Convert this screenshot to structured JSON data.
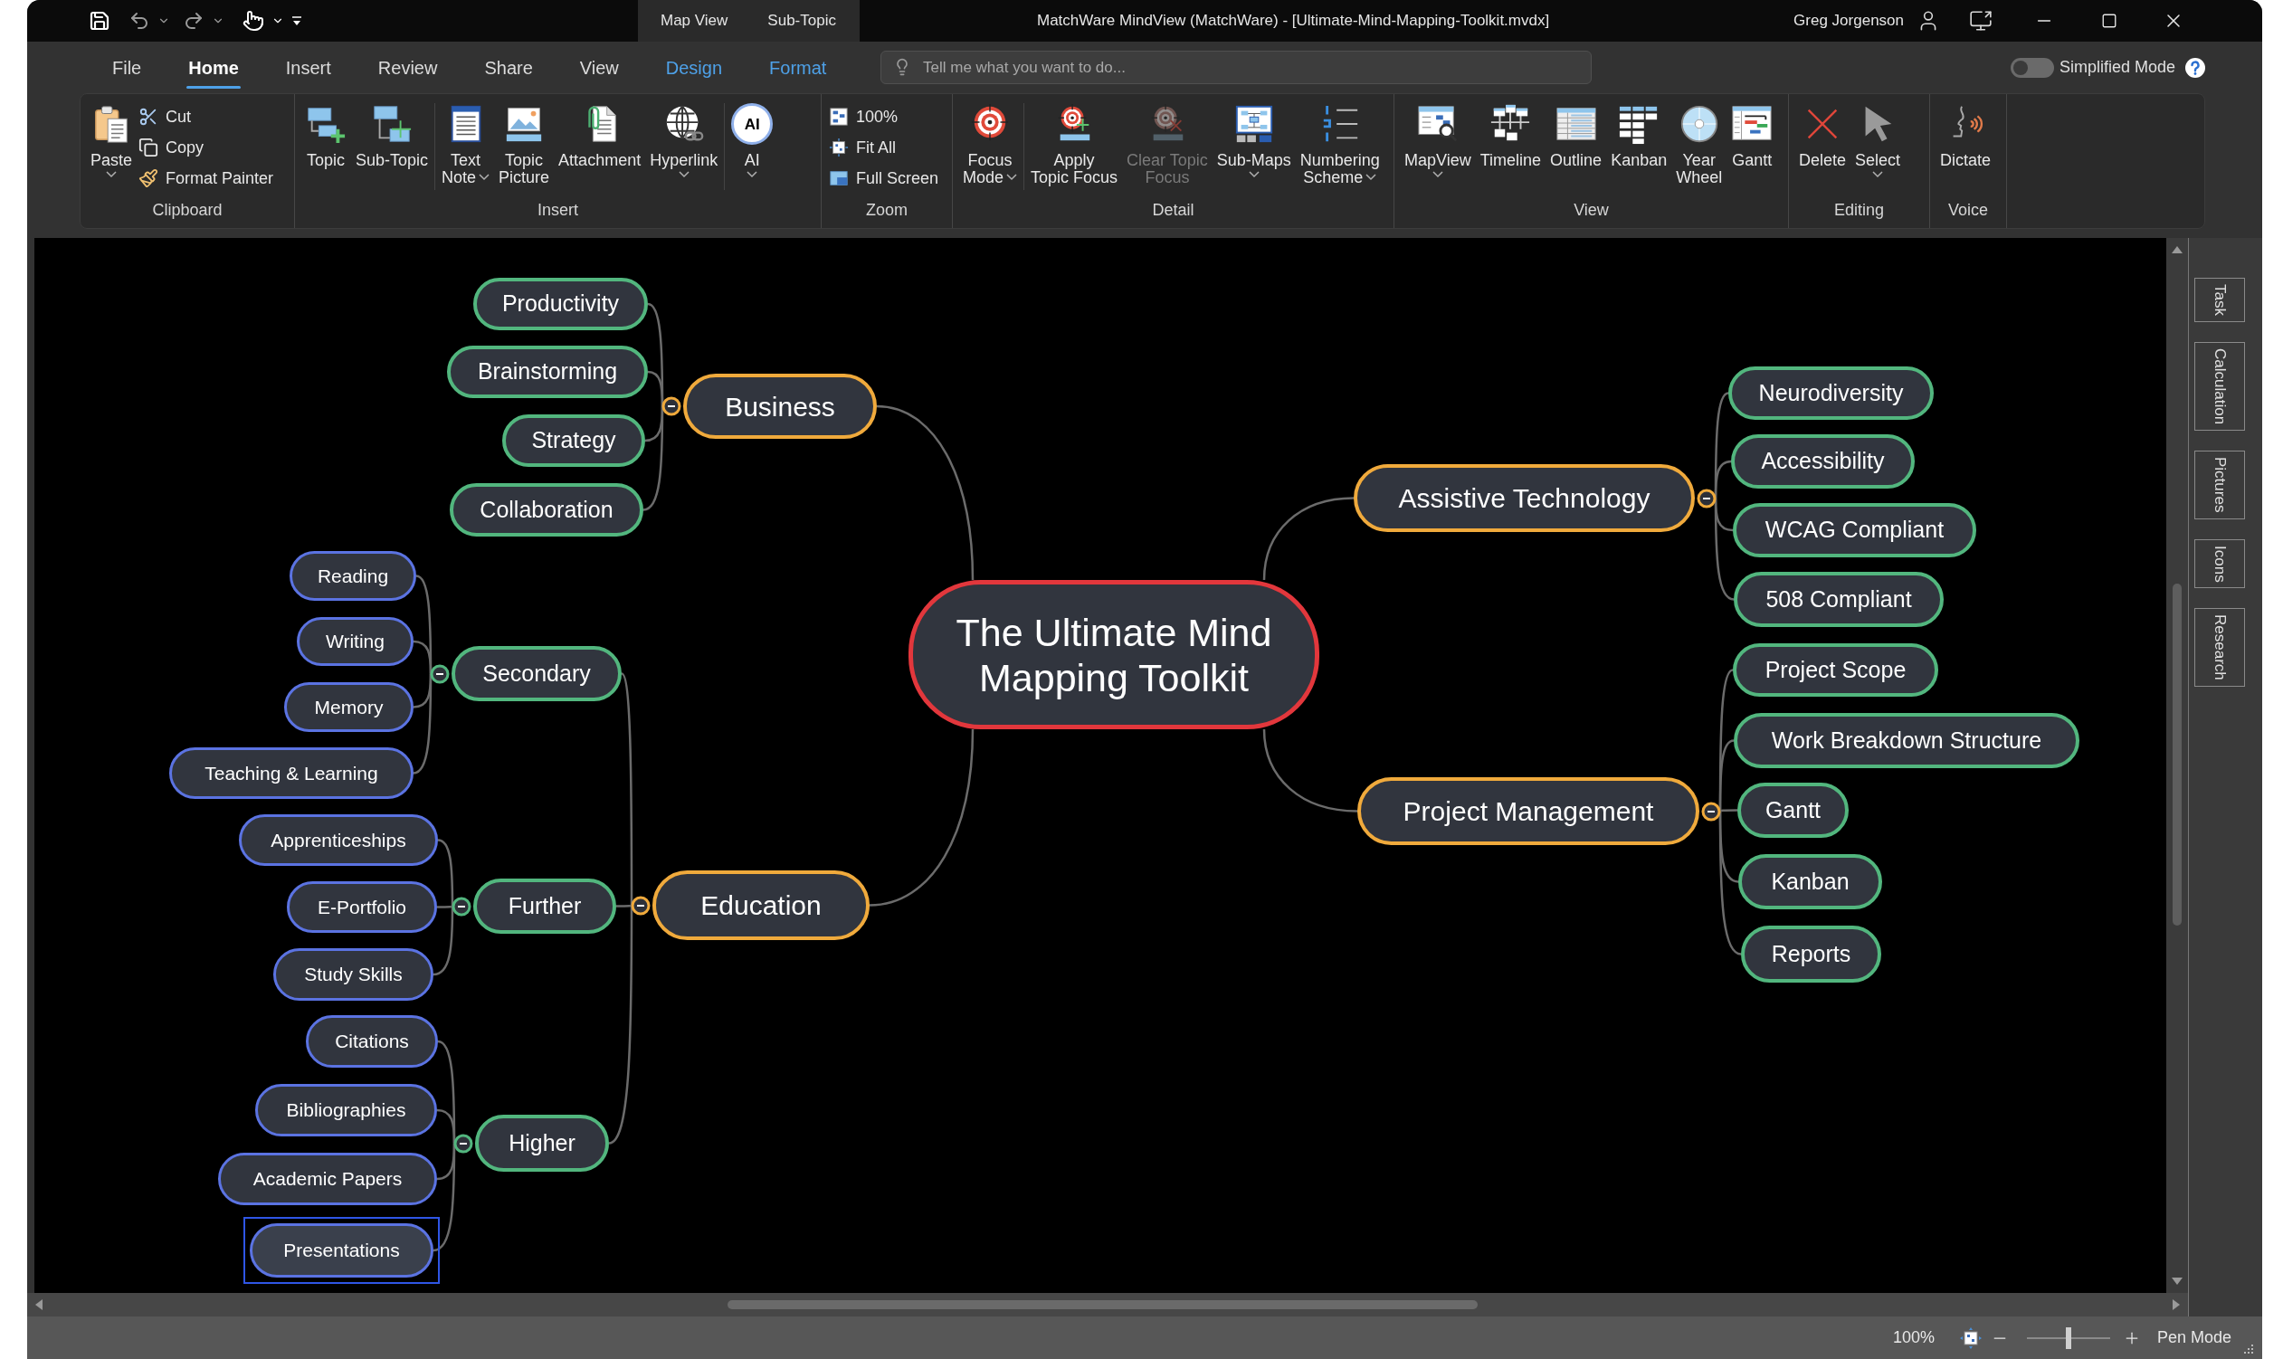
{
  "title_bar": {
    "context_tabs": [
      "Map View",
      "Sub-Topic"
    ],
    "title": "MatchWare MindView (MatchWare) - [Ultimate-Mind-Mapping-Toolkit.mvdx]",
    "user": "Greg Jorgenson"
  },
  "menu_tabs": [
    {
      "label": "File",
      "kind": "standard",
      "selected": false
    },
    {
      "label": "Home",
      "kind": "standard",
      "selected": true
    },
    {
      "label": "Insert",
      "kind": "standard",
      "selected": false
    },
    {
      "label": "Review",
      "kind": "standard",
      "selected": false
    },
    {
      "label": "Share",
      "kind": "standard",
      "selected": false
    },
    {
      "label": "View",
      "kind": "standard",
      "selected": false
    },
    {
      "label": "Design",
      "kind": "contextual",
      "selected": false
    },
    {
      "label": "Format",
      "kind": "contextual",
      "selected": false
    }
  ],
  "search": {
    "placeholder": "Tell me what you want to do..."
  },
  "simplified_mode": {
    "label": "Simplified Mode",
    "on": false
  },
  "ribbon": {
    "groups": [
      {
        "label": "Clipboard",
        "items": [
          {
            "label": "Paste",
            "kind": "large",
            "dropdown": true
          },
          {
            "label": "Cut",
            "kind": "small"
          },
          {
            "label": "Copy",
            "kind": "small"
          },
          {
            "label": "Format Painter",
            "kind": "small"
          }
        ]
      },
      {
        "label": "Insert",
        "items": [
          {
            "label": "Topic",
            "kind": "large"
          },
          {
            "label": "Sub-Topic",
            "kind": "large"
          },
          {
            "label": "Text\nNote",
            "kind": "large",
            "dropdown": true
          },
          {
            "label": "Topic\nPicture",
            "kind": "large"
          },
          {
            "label": "Attachment",
            "kind": "large"
          },
          {
            "label": "Hyperlink",
            "kind": "large",
            "dropdown": true
          },
          {
            "label": "AI",
            "kind": "large",
            "dropdown": true,
            "icon_text": "AI"
          }
        ]
      },
      {
        "label": "Zoom",
        "items": [
          {
            "label": "100%",
            "kind": "small"
          },
          {
            "label": "Fit All",
            "kind": "small"
          },
          {
            "label": "Full Screen",
            "kind": "small"
          }
        ]
      },
      {
        "label": "Detail",
        "items": [
          {
            "label": "Focus\nMode",
            "kind": "large",
            "dropdown": true,
            "disabled": false
          },
          {
            "label": "Apply\nTopic Focus",
            "kind": "large",
            "disabled": false
          },
          {
            "label": "Clear Topic\nFocus",
            "kind": "large",
            "disabled": true
          },
          {
            "label": "Sub-Maps",
            "kind": "large",
            "dropdown": true,
            "disabled": false
          },
          {
            "label": "Numbering\nScheme",
            "kind": "large",
            "dropdown": true,
            "disabled": false
          }
        ]
      },
      {
        "label": "View",
        "items": [
          {
            "label": "MapView",
            "kind": "large",
            "dropdown": true
          },
          {
            "label": "Timeline",
            "kind": "large"
          },
          {
            "label": "Outline",
            "kind": "large"
          },
          {
            "label": "Kanban",
            "kind": "large"
          },
          {
            "label": "Year\nWheel",
            "kind": "large"
          },
          {
            "label": "Gantt",
            "kind": "large"
          }
        ]
      },
      {
        "label": "Editing",
        "items": [
          {
            "label": "Delete",
            "kind": "large"
          },
          {
            "label": "Select",
            "kind": "large",
            "dropdown": true
          }
        ]
      },
      {
        "label": "Voice",
        "items": [
          {
            "label": "Dictate",
            "kind": "large"
          }
        ]
      }
    ]
  },
  "mind_map": {
    "central_topic": {
      "text": "The Ultimate Mind Mapping Toolkit",
      "selected": false
    },
    "branches": [
      {
        "text": "Business",
        "selected": false,
        "expanded": true,
        "children": [
          {
            "text": "Productivity",
            "selected": false
          },
          {
            "text": "Brainstorming",
            "selected": false
          },
          {
            "text": "Strategy",
            "selected": false
          },
          {
            "text": "Collaboration",
            "selected": false
          }
        ]
      },
      {
        "text": "Education",
        "selected": false,
        "expanded": true,
        "children": [
          {
            "text": "Secondary",
            "selected": false,
            "expanded": true,
            "children": [
              {
                "text": "Reading",
                "selected": false
              },
              {
                "text": "Writing",
                "selected": false
              },
              {
                "text": "Memory",
                "selected": false
              },
              {
                "text": "Teaching & Learning",
                "selected": false
              }
            ]
          },
          {
            "text": "Further",
            "selected": false,
            "expanded": true,
            "children": [
              {
                "text": "Apprenticeships",
                "selected": false
              },
              {
                "text": "E-Portfolio",
                "selected": false
              },
              {
                "text": "Study Skills",
                "selected": false
              }
            ]
          },
          {
            "text": "Higher",
            "selected": false,
            "expanded": true,
            "children": [
              {
                "text": "Citations",
                "selected": false
              },
              {
                "text": "Bibliographies",
                "selected": false
              },
              {
                "text": "Academic Papers",
                "selected": false
              },
              {
                "text": "Presentations",
                "selected": true
              }
            ]
          }
        ]
      },
      {
        "text": "Assistive Technology",
        "selected": false,
        "expanded": true,
        "children": [
          {
            "text": "Neurodiversity",
            "selected": false
          },
          {
            "text": "Accessibility",
            "selected": false
          },
          {
            "text": "WCAG Compliant",
            "selected": false
          },
          {
            "text": "508 Compliant",
            "selected": false
          }
        ]
      },
      {
        "text": "Project Management",
        "selected": false,
        "expanded": true,
        "children": [
          {
            "text": "Project Scope",
            "selected": false
          },
          {
            "text": "Work Breakdown Structure",
            "selected": false
          },
          {
            "text": "Gantt",
            "selected": false
          },
          {
            "text": "Kanban",
            "selected": false
          },
          {
            "text": "Reports",
            "selected": false
          }
        ]
      }
    ]
  },
  "side_tabs": [
    {
      "label": "Task",
      "selected": false
    },
    {
      "label": "Calculation",
      "selected": false
    },
    {
      "label": "Pictures",
      "selected": false
    },
    {
      "label": "Icons",
      "selected": false
    },
    {
      "label": "Research",
      "selected": false
    }
  ],
  "status_bar": {
    "zoom": "100%",
    "zoom_slider": {
      "level": 0.5
    },
    "pen_mode": "Pen Mode"
  }
}
